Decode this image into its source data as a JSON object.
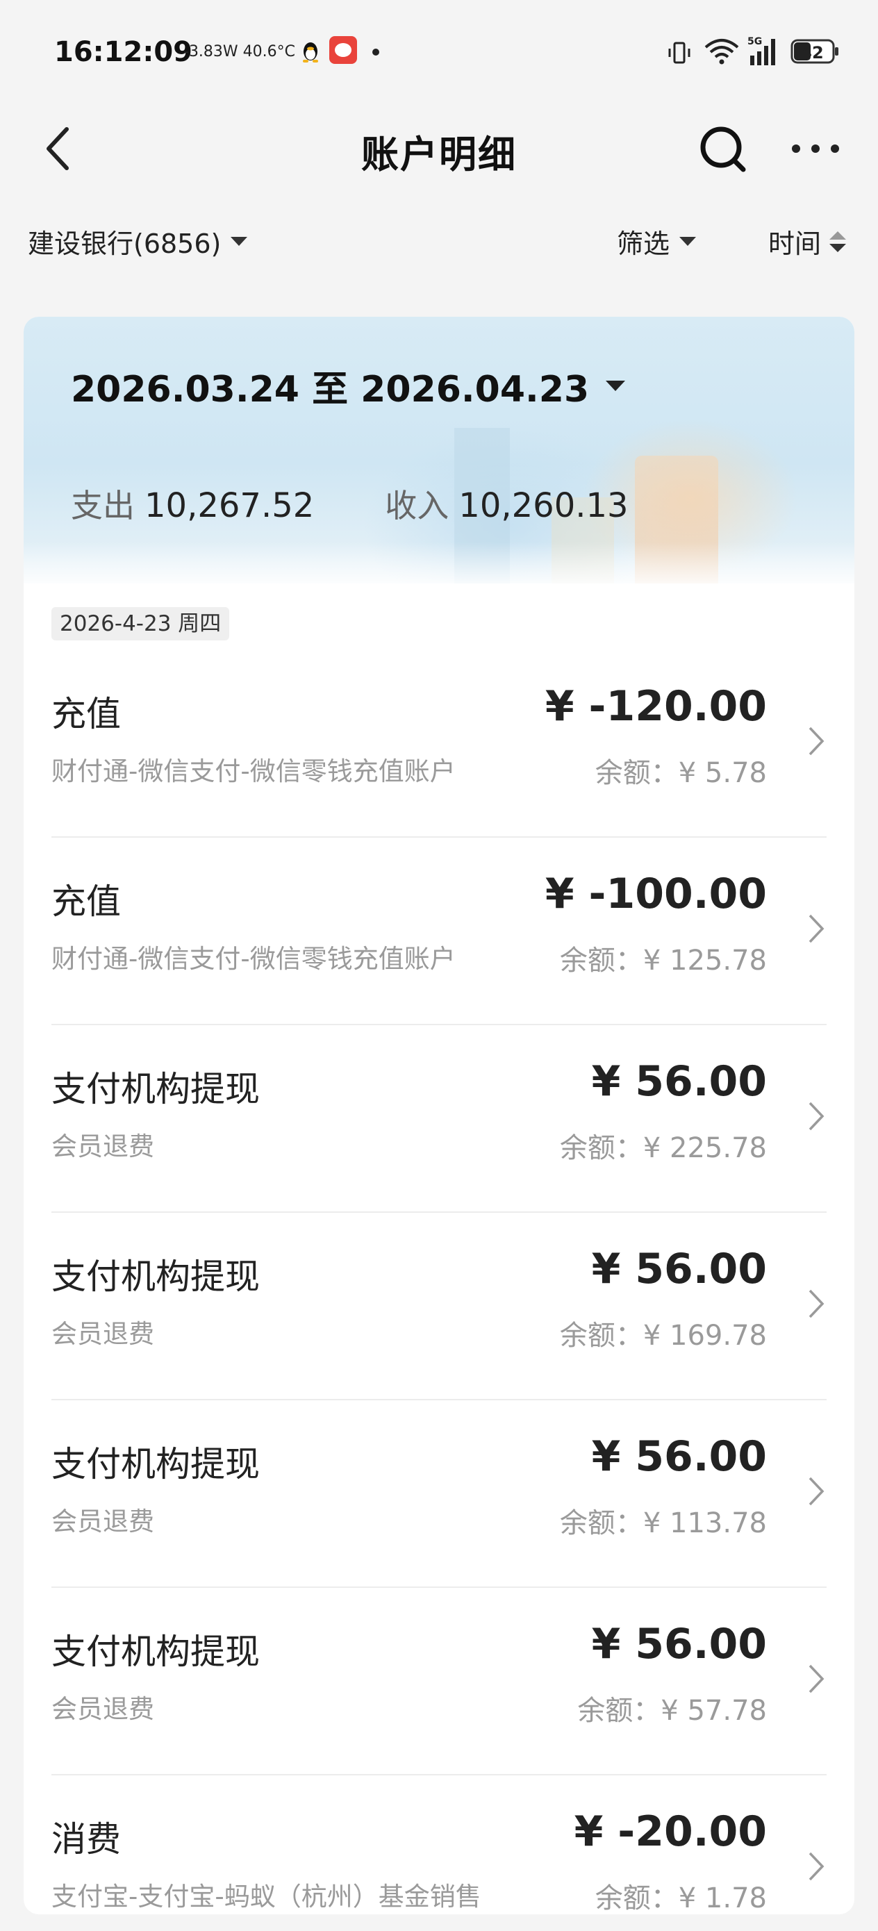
{
  "status_bar": {
    "time": "16:12:09",
    "info": "-3.83W 40.6°C",
    "network": "5G",
    "battery": "42"
  },
  "nav": {
    "title": "账户明细"
  },
  "filters": {
    "account": "建设银行(6856)",
    "filter_label": "筛选",
    "time_label": "时间"
  },
  "summary": {
    "date_range": "2026.03.24 至 2026.04.23",
    "expense_label": "支出",
    "expense_value": "10,267.52",
    "income_label": "收入",
    "income_value": "10,260.13"
  },
  "date_group": "2026-4-23 周四",
  "transactions": [
    {
      "title": "充值",
      "desc": "财付通-微信支付-微信零钱充值账户",
      "amount": "¥ -120.00",
      "balance": "余额：¥ 5.78"
    },
    {
      "title": "充值",
      "desc": "财付通-微信支付-微信零钱充值账户",
      "amount": "¥ -100.00",
      "balance": "余额：¥ 125.78"
    },
    {
      "title": "支付机构提现",
      "desc": "会员退费",
      "amount": "¥ 56.00",
      "balance": "余额：¥ 225.78"
    },
    {
      "title": "支付机构提现",
      "desc": "会员退费",
      "amount": "¥ 56.00",
      "balance": "余额：¥ 169.78"
    },
    {
      "title": "支付机构提现",
      "desc": "会员退费",
      "amount": "¥ 56.00",
      "balance": "余额：¥ 113.78"
    },
    {
      "title": "支付机构提现",
      "desc": "会员退费",
      "amount": "¥ 56.00",
      "balance": "余额：¥ 57.78"
    },
    {
      "title": "消费",
      "desc": "支付宝-支付宝-蚂蚁（杭州）基金销售",
      "amount": "¥ -20.00",
      "balance": "余额：¥ 1.78"
    }
  ]
}
